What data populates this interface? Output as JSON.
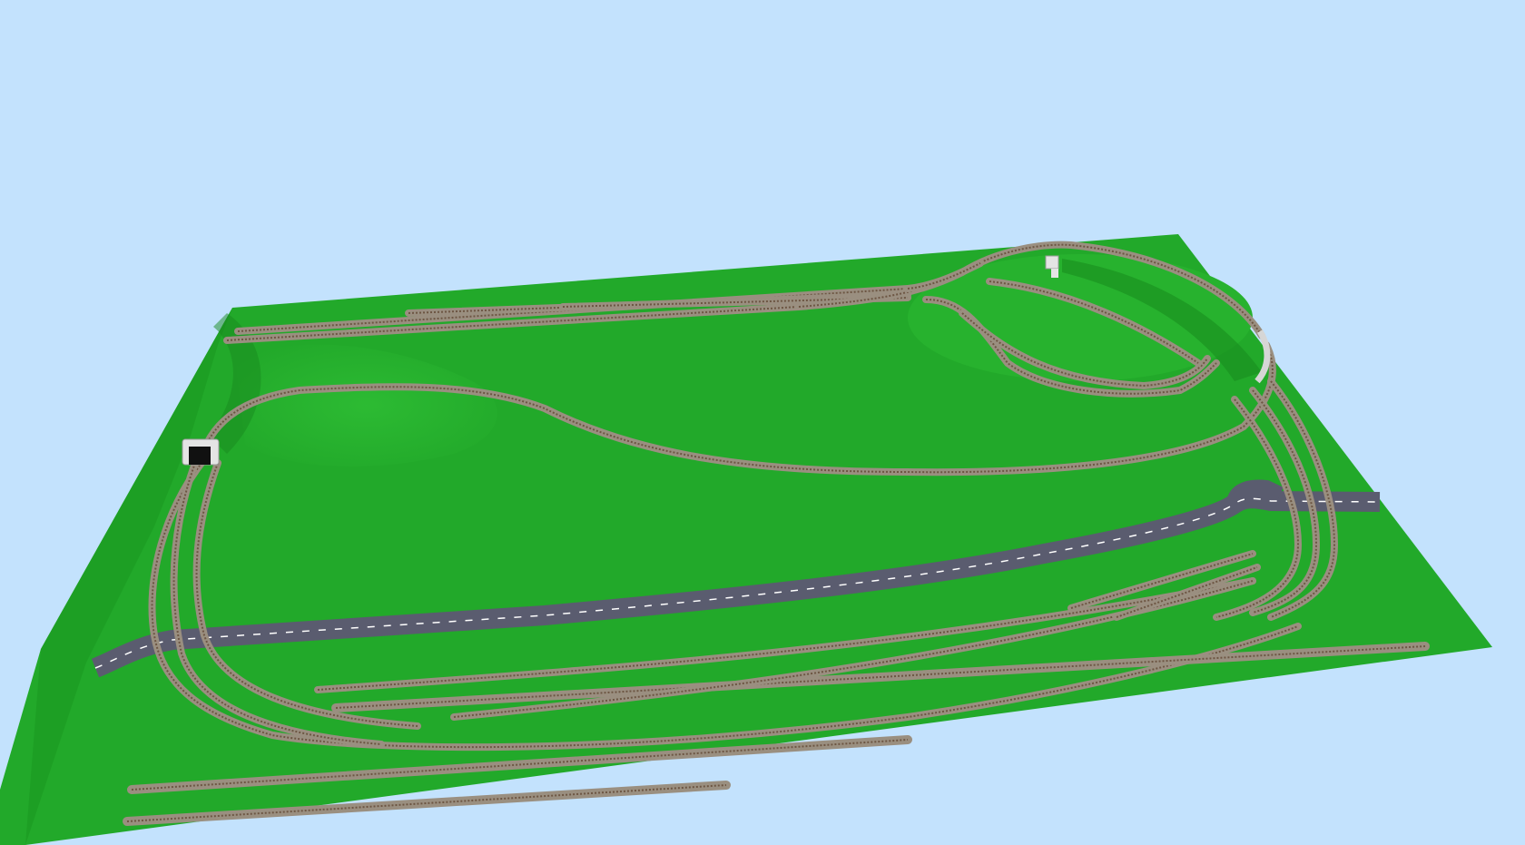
{
  "scene": {
    "sky_color": "#c3e2fd",
    "baseboard_color": "#22a92a",
    "baseboard_shadow_color": "#148f1b",
    "ballast_color": "#9a8f80",
    "rail_color": "#6d5643",
    "road_color": "#5a5c6f",
    "road_marking_color": "#ffffff",
    "tunnel_portal_color": "#e4e4e4",
    "tunnel_opening_color": "#111111",
    "icon_names": [
      "tunnel-portal-icon",
      "road-icon",
      "track-icon"
    ]
  }
}
